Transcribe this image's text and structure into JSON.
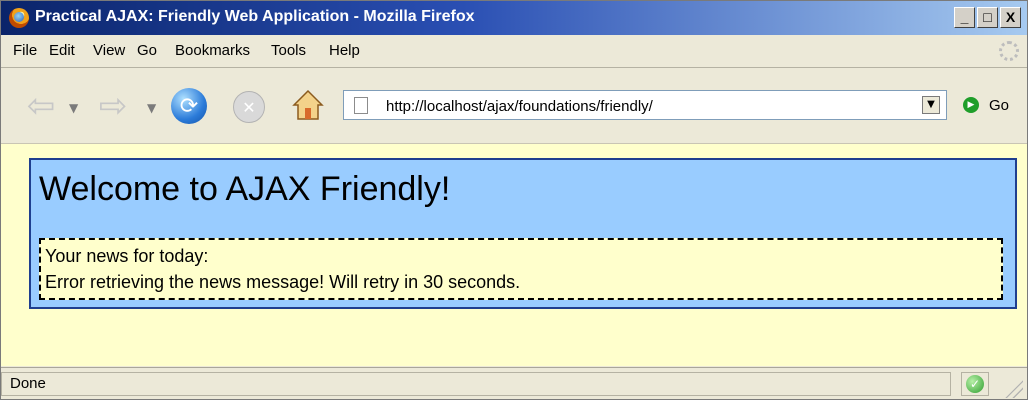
{
  "window": {
    "title": "Practical AJAX: Friendly Web Application - Mozilla Firefox",
    "buttons": {
      "minimize": "_",
      "maximize": "□",
      "close": "X"
    }
  },
  "menubar": {
    "items": [
      "File",
      "Edit",
      "View",
      "Go",
      "Bookmarks",
      "Tools",
      "Help"
    ]
  },
  "toolbar": {
    "address": "http://localhost/ajax/foundations/friendly/",
    "go_label": "Go"
  },
  "content": {
    "heading": "Welcome to AJAX Friendly!",
    "news_title": "Your news for today:",
    "news_message": "Error retrieving the news message! Will retry in 30 seconds."
  },
  "statusbar": {
    "text": "Done"
  },
  "colors": {
    "page_background": "#ffffcc",
    "panel_background": "#99ccff",
    "panel_border": "#1f3f8f"
  }
}
